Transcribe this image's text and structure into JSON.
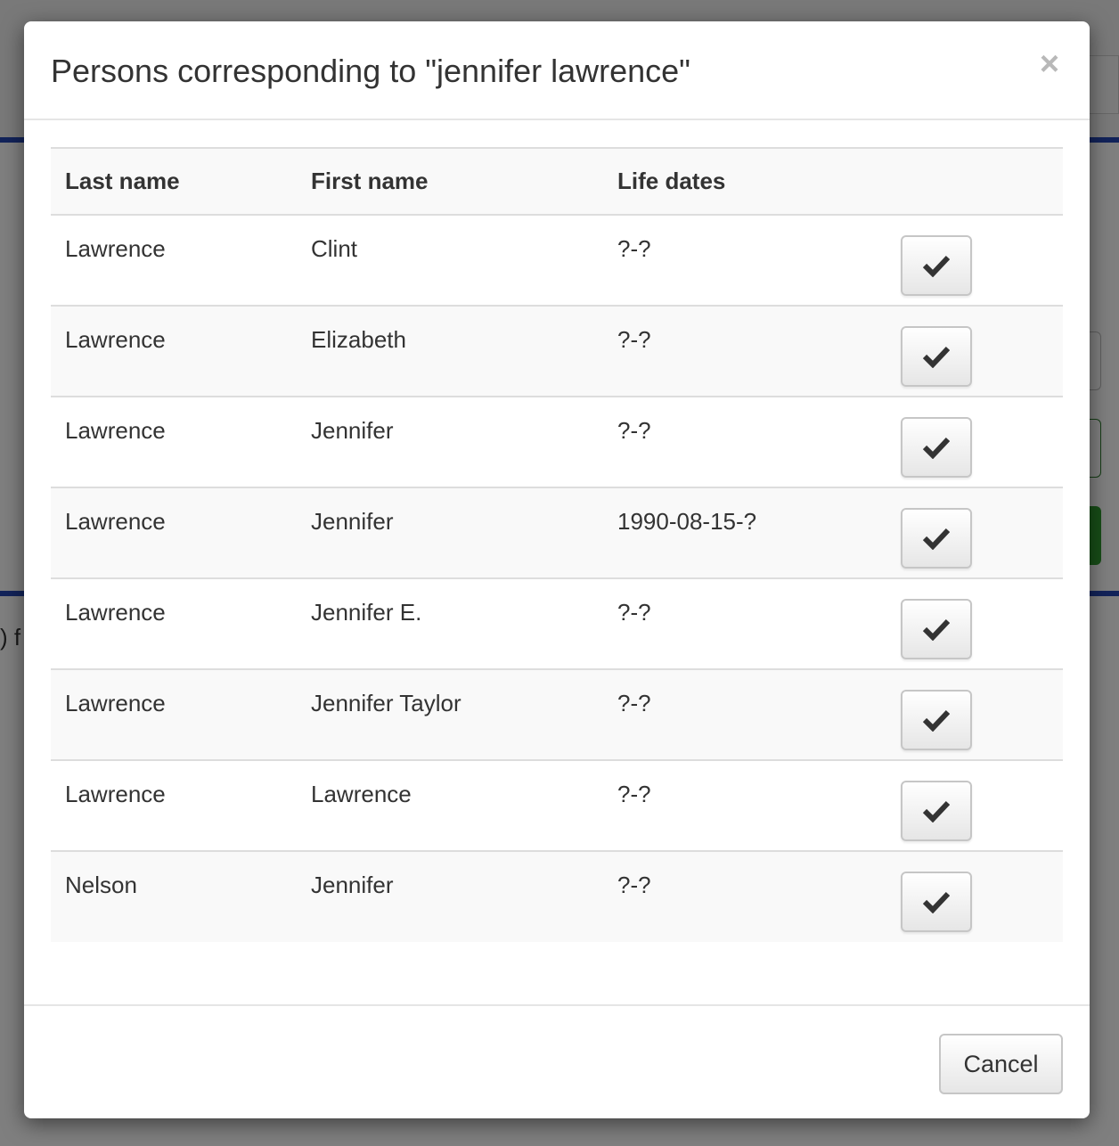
{
  "background": {
    "partial_text": ") f"
  },
  "modal": {
    "title": "Persons corresponding to \"jennifer lawrence\"",
    "close_icon": "×",
    "table": {
      "headers": [
        "Last name",
        "First name",
        "Life dates",
        ""
      ],
      "rows": [
        {
          "last_name": "Lawrence",
          "first_name": "Clint",
          "life_dates": "?-?"
        },
        {
          "last_name": "Lawrence",
          "first_name": "Elizabeth",
          "life_dates": "?-?"
        },
        {
          "last_name": "Lawrence",
          "first_name": "Jennifer",
          "life_dates": "?-?"
        },
        {
          "last_name": "Lawrence",
          "first_name": "Jennifer",
          "life_dates": "1990-08-15-?"
        },
        {
          "last_name": "Lawrence",
          "first_name": "Jennifer E.",
          "life_dates": "?-?"
        },
        {
          "last_name": "Lawrence",
          "first_name": "Jennifer Taylor",
          "life_dates": "?-?"
        },
        {
          "last_name": "Lawrence",
          "first_name": "Lawrence",
          "life_dates": "?-?"
        },
        {
          "last_name": "Nelson",
          "first_name": "Jennifer",
          "life_dates": "?-?"
        }
      ],
      "row_action_icon": "check-icon"
    },
    "footer": {
      "cancel_label": "Cancel"
    }
  },
  "colors": {
    "accent_line": "#2546b4",
    "green_button": "#2f9a2f"
  }
}
